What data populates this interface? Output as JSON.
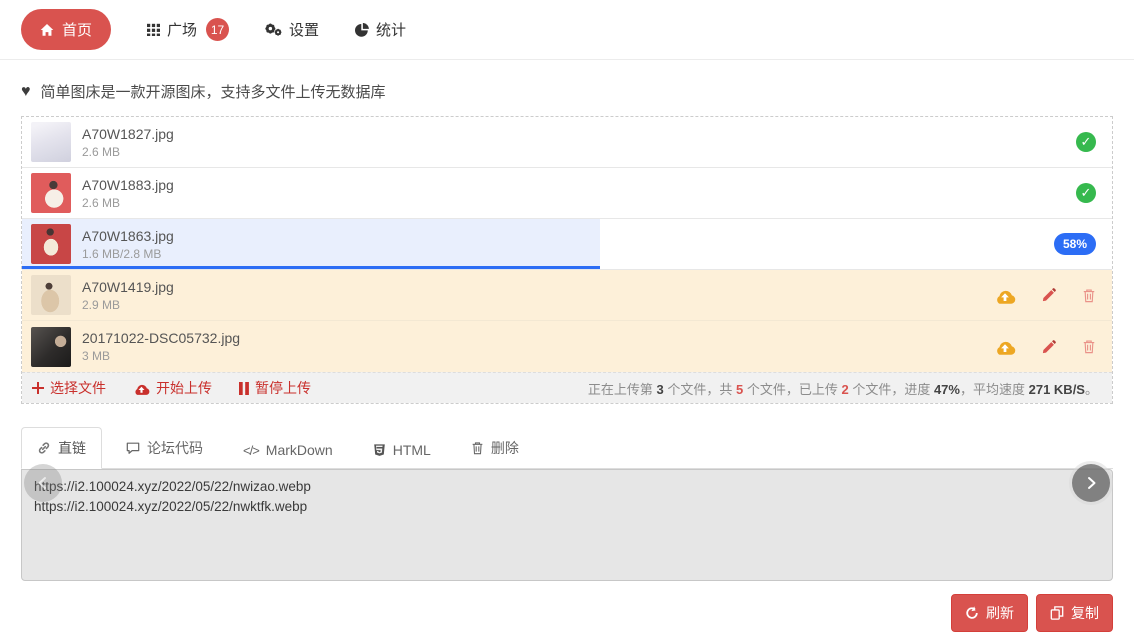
{
  "nav": {
    "home": {
      "label": "首页"
    },
    "plaza": {
      "label": "广场",
      "badge": "17"
    },
    "settings": {
      "label": "设置"
    },
    "stats": {
      "label": "统计"
    }
  },
  "tagline": "简单图床是一款开源图床，支持多文件上传无数据库",
  "uploader": {
    "files": [
      {
        "name": "A70W1827.jpg",
        "size": "2.6 MB",
        "status": "success"
      },
      {
        "name": "A70W1883.jpg",
        "size": "2.6 MB",
        "status": "success"
      },
      {
        "name": "A70W1863.jpg",
        "size": "1.6 MB/2.8 MB",
        "status": "uploading",
        "progress_label": "58%",
        "fill_percent": "53%"
      },
      {
        "name": "A70W1419.jpg",
        "size": "2.9 MB",
        "status": "queued"
      },
      {
        "name": "20171022-DSC05732.jpg",
        "size": "3 MB",
        "status": "queued"
      }
    ],
    "check_glyph": "✓",
    "toolbar": {
      "pick_label": "选择文件",
      "start_label": "开始上传",
      "pause_label": "暂停上传"
    },
    "status": {
      "t1": "正在上传第 ",
      "n1": "3",
      "t2": " 个文件，共 ",
      "n2": "5",
      "t3": " 个文件，已上传 ",
      "n3": "2",
      "t4": " 个文件，进度 ",
      "n4": "47%",
      "t5": "，平均速度 ",
      "n5": "271 KB/S",
      "t6": "。"
    }
  },
  "tabs": {
    "direct": "直链",
    "forum": "论坛代码",
    "markdown": "MarkDown",
    "html": "HTML",
    "delete": "删除",
    "code_glyph": "</>"
  },
  "output": {
    "text": "https://i2.100024.xyz/2022/05/22/nwizao.webp\nhttps://i2.100024.xyz/2022/05/22/nwktfk.webp"
  },
  "actions": {
    "refresh_label": "刷新",
    "copy_label": "复制"
  },
  "heart_glyph": "♥",
  "colors": {
    "accent_red": "#d9534f",
    "link_red": "#c9302c",
    "success_green": "#36b94e",
    "progress_blue": "#2c6df5",
    "progress_fill": "#e9effd",
    "queued_row_bg": "#fdf0d9",
    "toolbar_bg": "#f1f1f1",
    "output_bg": "#e6e6e6"
  }
}
